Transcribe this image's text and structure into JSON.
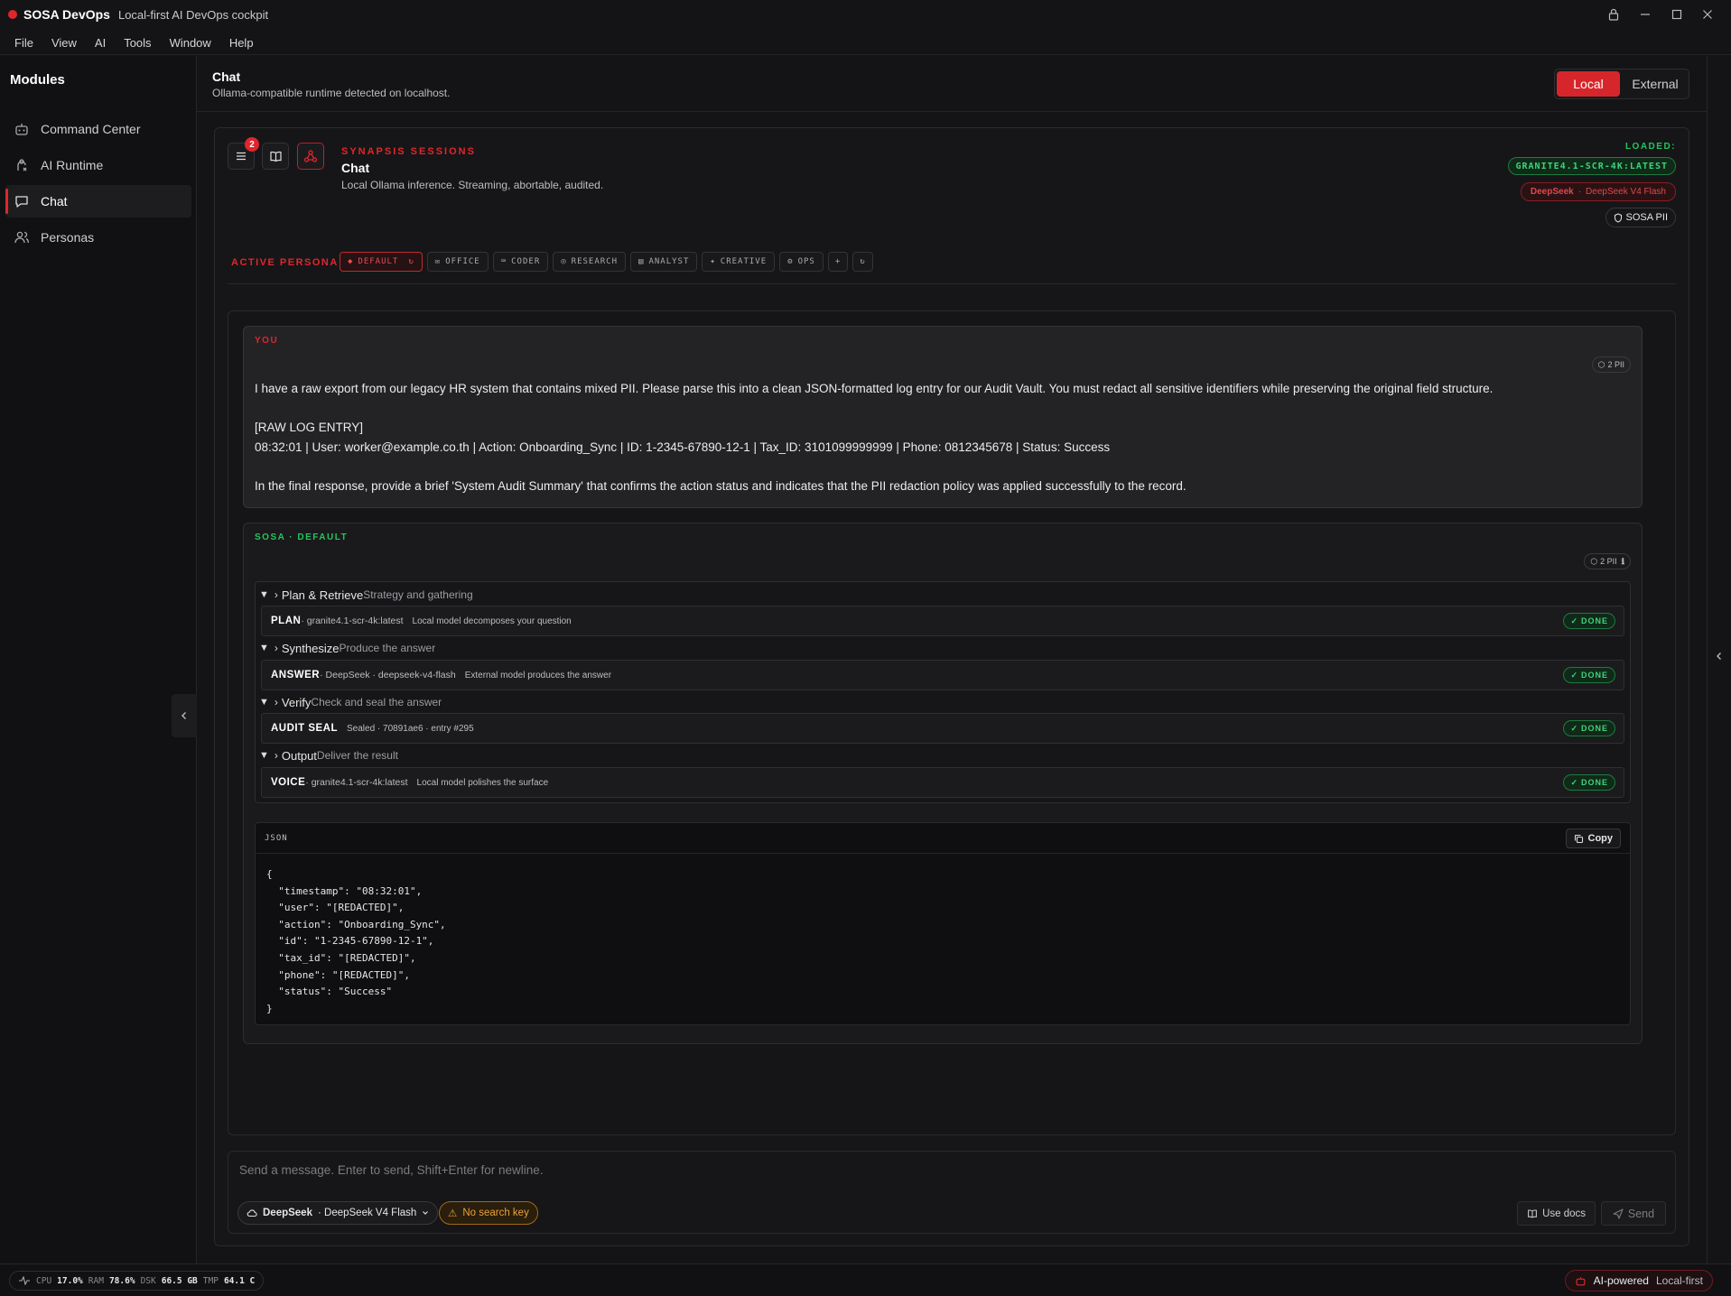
{
  "titlebar": {
    "app_name": "SOSA DevOps",
    "subtitle": "Local-first AI DevOps cockpit"
  },
  "menu": [
    "File",
    "View",
    "AI",
    "Tools",
    "Window",
    "Help"
  ],
  "sidebar": {
    "heading": "Modules",
    "items": [
      {
        "label": "Command Center",
        "icon": "robot-icon"
      },
      {
        "label": "AI Runtime",
        "icon": "runtime-icon"
      },
      {
        "label": "Chat",
        "icon": "chat-icon",
        "active": true
      },
      {
        "label": "Personas",
        "icon": "users-icon"
      }
    ]
  },
  "header": {
    "title": "Chat",
    "subtitle": "Ollama-compatible runtime detected on localhost.",
    "mode_local": "Local",
    "mode_external": "External"
  },
  "session": {
    "badge_count": "2",
    "kicker": "SYNAPSIS SESSIONS",
    "title": "Chat",
    "subtitle": "Local Ollama inference. Streaming, abortable, audited.",
    "loaded_label": "LOADED:",
    "loaded_model": "GRANITE4.1-SCR-4K:LATEST",
    "external_provider": "DeepSeek",
    "external_model": "DeepSeek V4 Flash",
    "pii_label": "SOSA PII"
  },
  "personas": {
    "label": "ACTIVE PERSONA",
    "items": [
      "DEFAULT",
      "OFFICE",
      "CODER",
      "RESEARCH",
      "ANALYST",
      "CREATIVE",
      "OPS"
    ]
  },
  "user_message": {
    "label": "YOU",
    "pii": "2 PII",
    "lines": [
      "I have a raw export from our legacy HR system that contains mixed PII. Please parse this into a clean JSON-formatted log entry for our Audit Vault. You must redact all sensitive identifiers while preserving the original field structure.",
      "",
      "[RAW LOG ENTRY]",
      "08:32:01 | User: worker@example.co.th | Action: Onboarding_Sync | ID: 1-2345-67890-12-1 | Tax_ID: 3101099999999 | Phone: 0812345678 | Status: Success",
      "",
      "In the final response, provide a brief 'System Audit Summary' that confirms the action status and indicates that the PII redaction policy was applied successfully to the record."
    ]
  },
  "ai_message": {
    "label": "SOSA · DEFAULT",
    "pii": "2 PII",
    "phases": [
      {
        "title": "Plan & Retrieve",
        "desc": "Strategy and gathering",
        "step": {
          "name": "PLAN",
          "model": " · granite4.1-scr-4k:latest",
          "desc": "Local model decomposes your question",
          "status": "DONE"
        }
      },
      {
        "title": "Synthesize",
        "desc": "Produce the answer",
        "step": {
          "name": "ANSWER",
          "model": " · DeepSeek · deepseek-v4-flash",
          "desc": "External model produces the answer",
          "status": "DONE"
        }
      },
      {
        "title": "Verify",
        "desc": "Check and seal the answer",
        "step": {
          "name": "AUDIT SEAL",
          "model": "",
          "desc": "Sealed · 70891ae6 · entry #295",
          "status": "DONE"
        }
      },
      {
        "title": "Output",
        "desc": "Deliver the result",
        "step": {
          "name": "VOICE",
          "model": " · granite4.1-scr-4k:latest",
          "desc": "Local model polishes the surface",
          "status": "DONE"
        }
      }
    ],
    "code": {
      "lang": "JSON",
      "copy_label": "Copy",
      "lines": [
        "{",
        "  \"timestamp\": \"08:32:01\",",
        "  \"user\": \"[REDACTED]\",",
        "  \"action\": \"Onboarding_Sync\",",
        "  \"id\": \"1-2345-67890-12-1\",",
        "  \"tax_id\": \"[REDACTED]\",",
        "  \"phone\": \"[REDACTED]\",",
        "  \"status\": \"Success\"",
        "}"
      ]
    }
  },
  "composer": {
    "placeholder": "Send a message. Enter to send, Shift+Enter for newline.",
    "provider": "DeepSeek",
    "provider_model": "· DeepSeek V4 Flash",
    "no_search_key": "No search key",
    "use_docs": "Use docs",
    "send": "Send"
  },
  "statusbar": {
    "cpu_label": "CPU",
    "cpu": "17.0%",
    "ram_label": "RAM",
    "ram": "78.6%",
    "dsk_label": "DSK",
    "dsk": "66.5 GB",
    "tmp_label": "TMP",
    "tmp": "64.1 C",
    "ai_powered": "AI-powered",
    "local_first": "Local-first"
  },
  "colors": {
    "accent": "#e0262b",
    "success": "#22c55e",
    "warning": "#e6a13a",
    "background": "#141416"
  }
}
